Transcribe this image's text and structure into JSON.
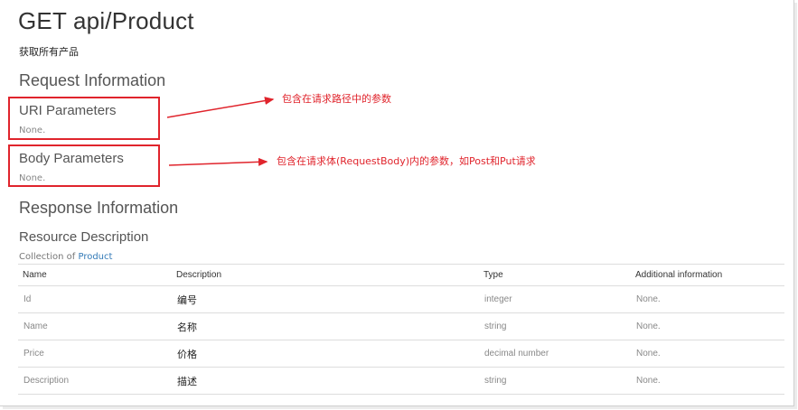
{
  "header": {
    "title": "GET api/Product",
    "subtitle": "获取所有产品"
  },
  "request": {
    "heading": "Request Information",
    "uri": {
      "heading": "URI Parameters",
      "value": "None."
    },
    "body": {
      "heading": "Body Parameters",
      "value": "None."
    }
  },
  "annotations": {
    "uri_note": "包含在请求路径中的参数",
    "body_note": "包含在请求体(RequestBody)内的参数，如Post和Put请求",
    "color": "#e0242c"
  },
  "response": {
    "heading": "Response Information",
    "resource_heading": "Resource Description",
    "collection_prefix": "Collection of",
    "collection_link": "Product",
    "table": {
      "columns": [
        "Name",
        "Description",
        "Type",
        "Additional information"
      ],
      "rows": [
        [
          "Id",
          "编号",
          "integer",
          "None."
        ],
        [
          "Name",
          "名称",
          "string",
          "None."
        ],
        [
          "Price",
          "价格",
          "decimal number",
          "None."
        ],
        [
          "Description",
          "描述",
          "string",
          "None."
        ]
      ]
    }
  }
}
